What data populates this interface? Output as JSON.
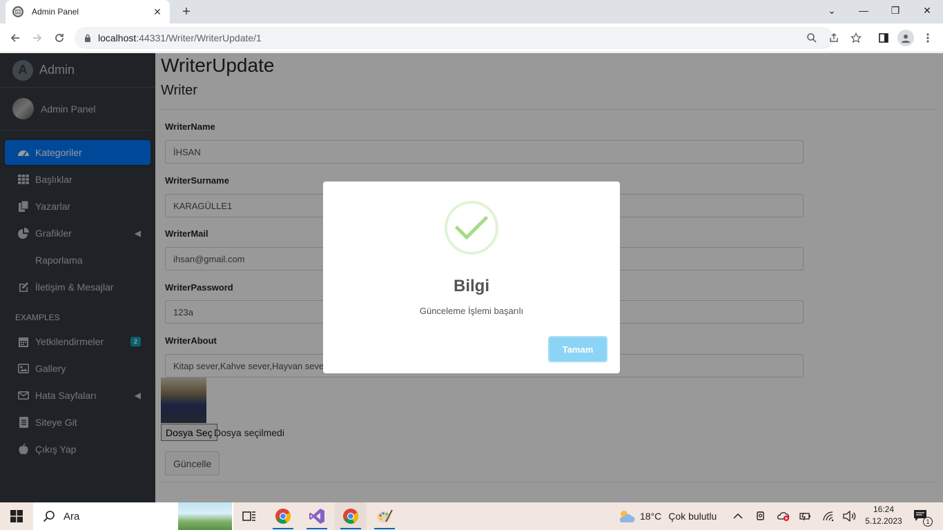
{
  "browser": {
    "tab_title": "Admin Panel",
    "url_host": "localhost",
    "url_path": ":44331/Writer/WriterUpdate/1"
  },
  "sidebar": {
    "brand": "Admin",
    "user_name": "Admin Panel",
    "items": [
      {
        "label": "Kategoriler",
        "icon": "dashboard-icon"
      },
      {
        "label": "Başlıklar",
        "icon": "grid-icon"
      },
      {
        "label": "Yazarlar",
        "icon": "copy-icon"
      },
      {
        "label": "Grafikler",
        "icon": "pie-chart-icon"
      },
      {
        "label": "Raporlama",
        "icon": ""
      },
      {
        "label": "İletişim & Mesajlar",
        "icon": "edit-icon"
      }
    ],
    "section_header": "EXAMPLES",
    "examples": [
      {
        "label": "Yetkilendirmeler",
        "icon": "calendar-icon",
        "badge": "2"
      },
      {
        "label": "Gallery",
        "icon": "image-icon"
      },
      {
        "label": "Hata Sayfaları",
        "icon": "envelope-icon"
      },
      {
        "label": "Siteye Git",
        "icon": "file-icon"
      },
      {
        "label": "Çıkış Yap",
        "icon": "apple-icon"
      }
    ]
  },
  "page": {
    "title": "WriterUpdate",
    "subtitle": "Writer",
    "fields": [
      {
        "label": "WriterName",
        "value": "İHSAN"
      },
      {
        "label": "WriterSurname",
        "value": "KARAGÜLLE1"
      },
      {
        "label": "WriterMail",
        "value": "ihsan@gmail.com"
      },
      {
        "label": "WriterPassword",
        "value": "123a"
      },
      {
        "label": "WriterAbout",
        "value": "Kitap sever,Kahve sever,Hayvan sever"
      }
    ],
    "file_button": "Dosya Seç",
    "file_status": "Dosya seçilmedi",
    "submit": "Güncelle"
  },
  "dialog": {
    "title": "Bilgi",
    "text": "Günceleme İşlemi başarılı",
    "button": "Tamam",
    "accent": "#a5dc86",
    "button_color": "#8cd4f5"
  },
  "taskbar": {
    "search_placeholder": "Ara",
    "weather": "18°C",
    "weather_text": "Çok bulutlu",
    "time": "16:24",
    "date": "5.12.2023",
    "notifications": "1"
  }
}
